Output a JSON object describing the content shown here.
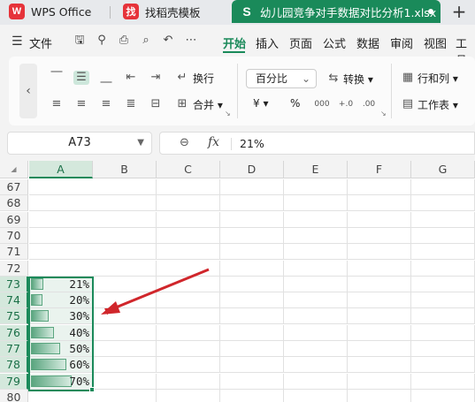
{
  "tabs": {
    "wps_label": "WPS Office",
    "daoke_label": "找稻壳模板",
    "file_label": "幼儿园竞争对手数据对比分析1.xlsx",
    "add_label": "+",
    "logo_wps": "W",
    "logo_daoke": "找",
    "logo_file": "S"
  },
  "menu": {
    "file_label": "文件",
    "items": [
      "开始",
      "插入",
      "页面",
      "公式",
      "数据",
      "审阅",
      "视图",
      "工具"
    ],
    "active_index": 0
  },
  "ribbon": {
    "wrap_text": "换行",
    "merge": "合并",
    "number_format": "百分比",
    "convert": "转换",
    "rows_cols": "行和列",
    "worksheet": "工作表",
    "currency_symbol": "¥",
    "percent_symbol": "%"
  },
  "formula_bar": {
    "cell_ref": "A73",
    "fx_label": "fx",
    "value": "21%"
  },
  "grid": {
    "columns": [
      "A",
      "B",
      "C",
      "D",
      "E",
      "F",
      "G"
    ],
    "selected_column": "A",
    "rows": [
      {
        "num": "67",
        "value": "",
        "bar": 0
      },
      {
        "num": "68",
        "value": "",
        "bar": 0
      },
      {
        "num": "69",
        "value": "",
        "bar": 0
      },
      {
        "num": "70",
        "value": "",
        "bar": 0
      },
      {
        "num": "71",
        "value": "",
        "bar": 0
      },
      {
        "num": "72",
        "value": "",
        "bar": 0
      },
      {
        "num": "73",
        "value": "21%",
        "bar": 0.21
      },
      {
        "num": "74",
        "value": "20%",
        "bar": 0.2
      },
      {
        "num": "75",
        "value": "30%",
        "bar": 0.3
      },
      {
        "num": "76",
        "value": "40%",
        "bar": 0.4
      },
      {
        "num": "77",
        "value": "50%",
        "bar": 0.5
      },
      {
        "num": "78",
        "value": "60%",
        "bar": 0.6
      },
      {
        "num": "79",
        "value": "70%",
        "bar": 0.7
      },
      {
        "num": "80",
        "value": "",
        "bar": 0
      }
    ]
  },
  "colors": {
    "accent": "#1a8a5a",
    "arrow": "#d0262b"
  }
}
